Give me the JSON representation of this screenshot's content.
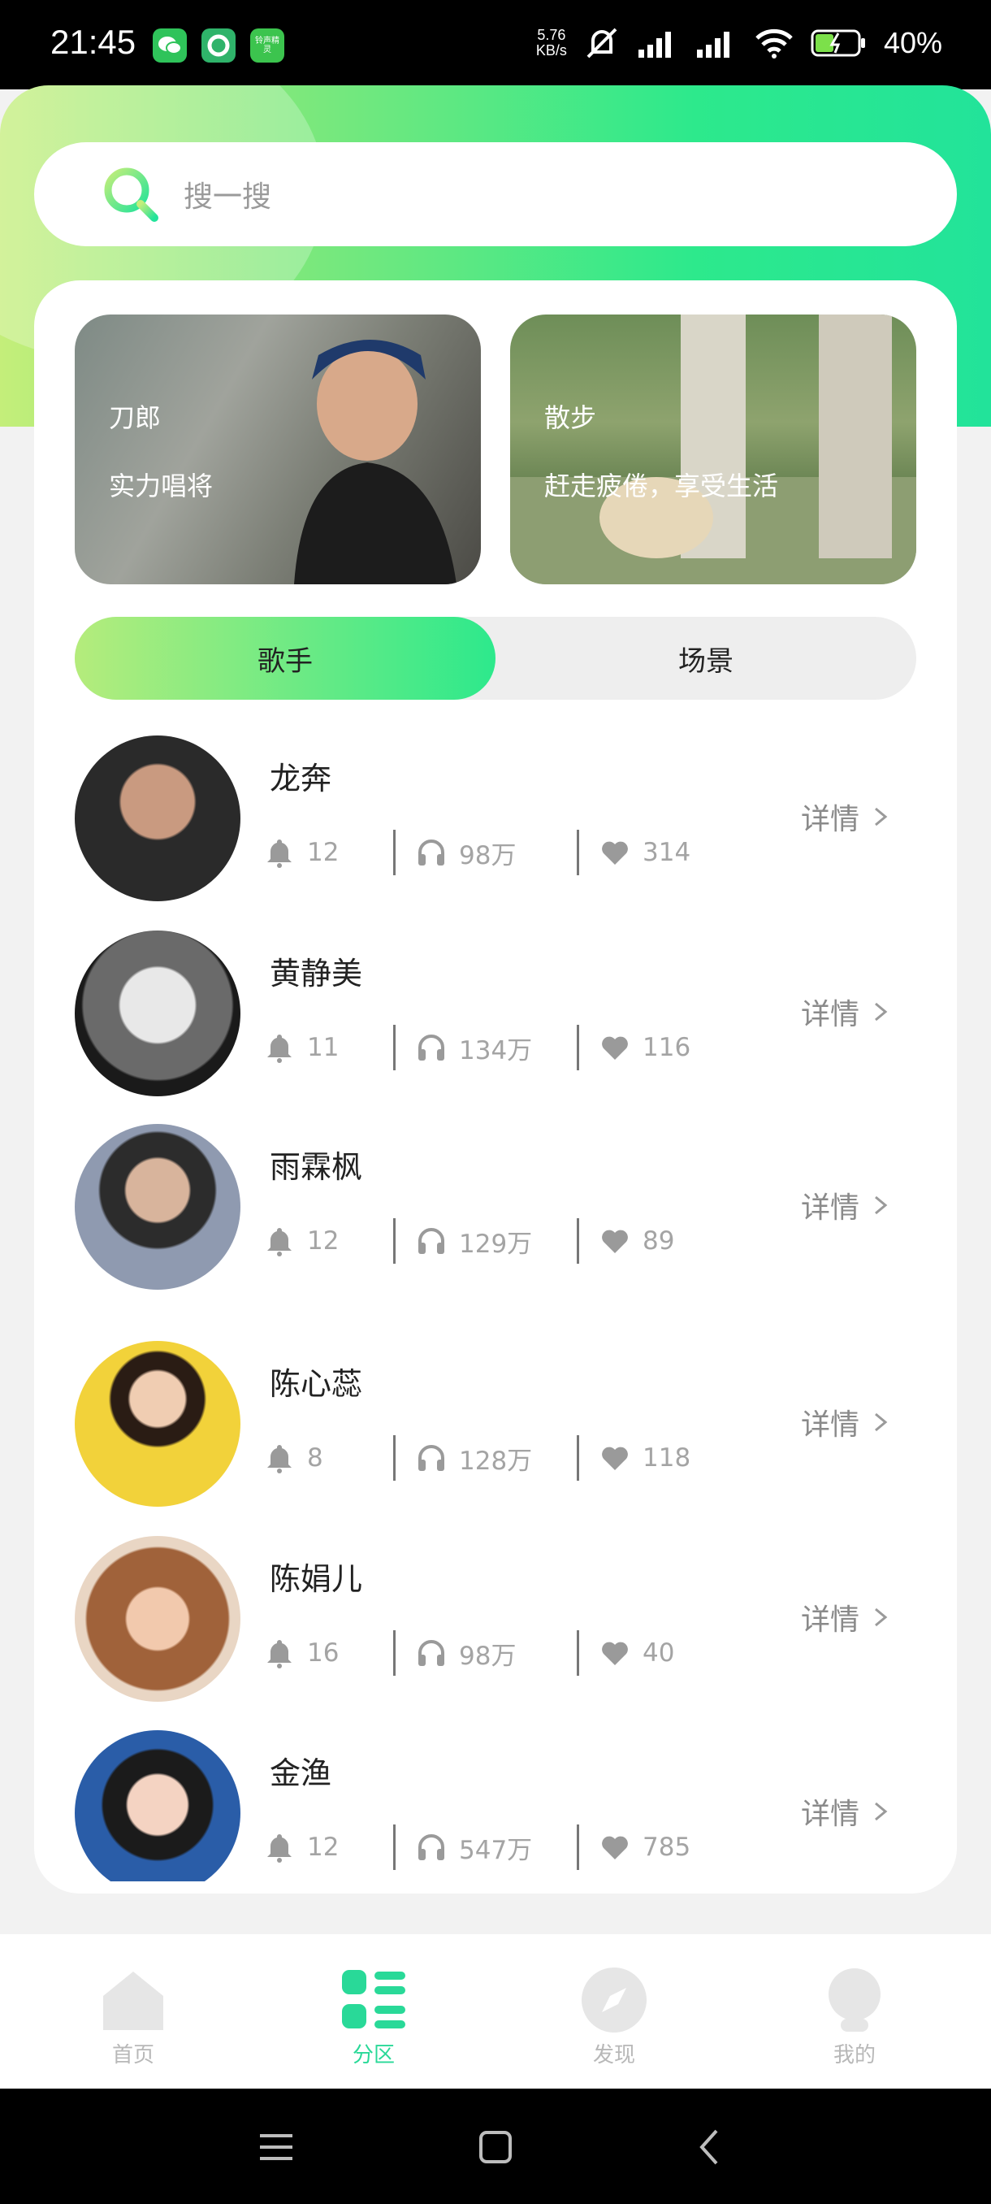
{
  "status_bar": {
    "time": "21:45",
    "net_speed_value": "5.76",
    "net_speed_unit": "KB/s",
    "mini_app_text": "铃声精灵",
    "battery_percent": "40%"
  },
  "search": {
    "placeholder": "搜一搜"
  },
  "banners": [
    {
      "title": "刀郎",
      "subtitle": "实力唱将"
    },
    {
      "title": "散步",
      "subtitle": "赶走疲倦，享受生活"
    }
  ],
  "tabs": [
    {
      "label": "歌手",
      "active": true
    },
    {
      "label": "场景",
      "active": false
    }
  ],
  "singers": [
    {
      "name": "龙奔",
      "subscribers": "12",
      "plays": "98万",
      "likes": "314",
      "detail_label": "详情"
    },
    {
      "name": "黄静美",
      "subscribers": "11",
      "plays": "134万",
      "likes": "116",
      "detail_label": "详情"
    },
    {
      "name": "雨霖枫",
      "subscribers": "12",
      "plays": "129万",
      "likes": "89",
      "detail_label": "详情"
    },
    {
      "name": "陈心蕊",
      "subscribers": "8",
      "plays": "128万",
      "likes": "118",
      "detail_label": "详情"
    },
    {
      "name": "陈娟儿",
      "subscribers": "16",
      "plays": "98万",
      "likes": "40",
      "detail_label": "详情"
    },
    {
      "name": "金渔",
      "subscribers": "12",
      "plays": "547万",
      "likes": "785",
      "detail_label": "详情"
    }
  ],
  "bottom_nav": [
    {
      "label": "首页",
      "icon": "home-icon",
      "active": false
    },
    {
      "label": "分区",
      "icon": "category-icon",
      "active": true
    },
    {
      "label": "发现",
      "icon": "compass-icon",
      "active": false
    },
    {
      "label": "我的",
      "icon": "profile-icon",
      "active": false
    }
  ],
  "colors": {
    "accent_start": "#c4ee7a",
    "accent_end": "#22e39a",
    "active_nav": "#29d998",
    "muted_text": "#a4a4a4"
  }
}
